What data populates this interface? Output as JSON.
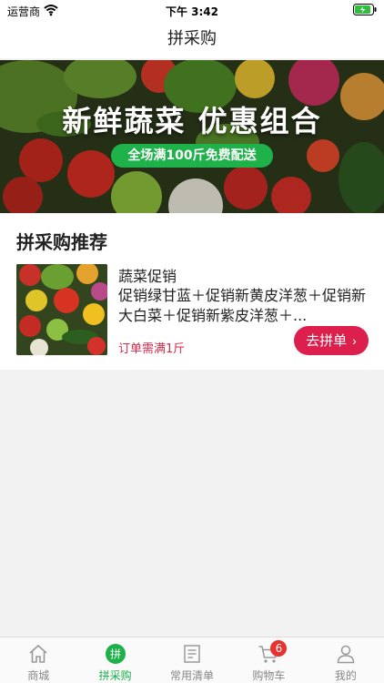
{
  "status_bar": {
    "carrier": "运营商",
    "time": "下午 3:42"
  },
  "nav": {
    "title": "拼采购"
  },
  "banner": {
    "title": "新鲜蔬菜 优惠组合",
    "subtitle": "全场满100斤免费配送"
  },
  "section": {
    "title": "拼采购推荐",
    "card": {
      "name": "蔬菜促销",
      "description": "促销绿甘蓝＋促销新黄皮洋葱＋促销新大白菜＋促销新紫皮洋葱＋...",
      "requirement": "订单需满1斤",
      "button_label": "去拼单"
    }
  },
  "tab_bar": {
    "items": [
      {
        "label": "商城",
        "icon": "home-icon"
      },
      {
        "label": "拼采购",
        "icon": "pin-icon",
        "icon_text": "拼",
        "active": true
      },
      {
        "label": "常用清单",
        "icon": "list-icon"
      },
      {
        "label": "购物车",
        "icon": "cart-icon",
        "badge": "6"
      },
      {
        "label": "我的",
        "icon": "user-icon"
      }
    ]
  },
  "colors": {
    "accent_green": "#1db04b",
    "accent_red": "#dc1f4d",
    "badge_red": "#e8322e"
  }
}
